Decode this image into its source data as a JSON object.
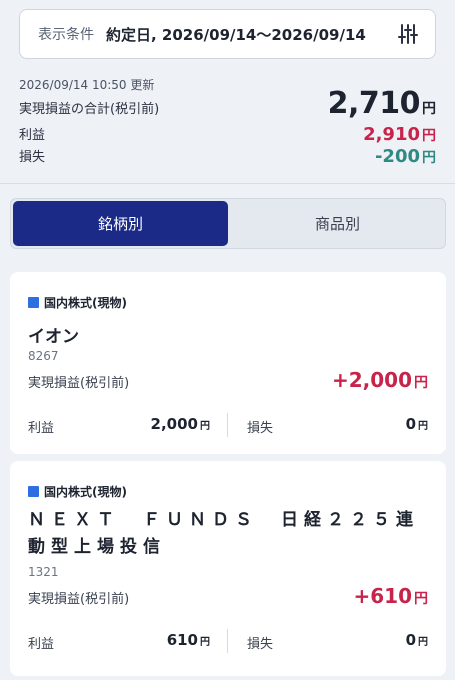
{
  "filter": {
    "label": "表示条件",
    "value": "約定日, 2026/09/14〜2026/09/14",
    "icon": "filter-sliders-icon"
  },
  "summary": {
    "updated": "2026/09/14 10:50 更新",
    "total_label": "実現損益の合計(税引前)",
    "total_value": "2,710",
    "profit_label": "利益",
    "profit_value": "2,910",
    "loss_label": "損失",
    "loss_value": "-200",
    "yen": "円"
  },
  "tabs": [
    {
      "label": "銘柄別",
      "active": true
    },
    {
      "label": "商品別",
      "active": false
    }
  ],
  "holdings": [
    {
      "category": "国内株式(現物)",
      "name": "イオン",
      "code": "8267",
      "realized_label": "実現損益(税引前)",
      "realized_value": "+2,000",
      "profit_label": "利益",
      "profit_value": "2,000",
      "loss_label": "損失",
      "loss_value": "0"
    },
    {
      "category": "国内株式(現物)",
      "name": "ＮＥＸＴ　ＦＵＮＤＳ　日経２２５連動型上場投信",
      "code": "1321",
      "realized_label": "実現損益(税引前)",
      "realized_value": "+610",
      "profit_label": "利益",
      "profit_value": "610",
      "loss_label": "損失",
      "loss_value": "0"
    }
  ],
  "colors": {
    "accent": "#1a2a86",
    "profit": "#c8234a",
    "loss": "#2e8a82",
    "category_marker": "#2f6ee0"
  }
}
